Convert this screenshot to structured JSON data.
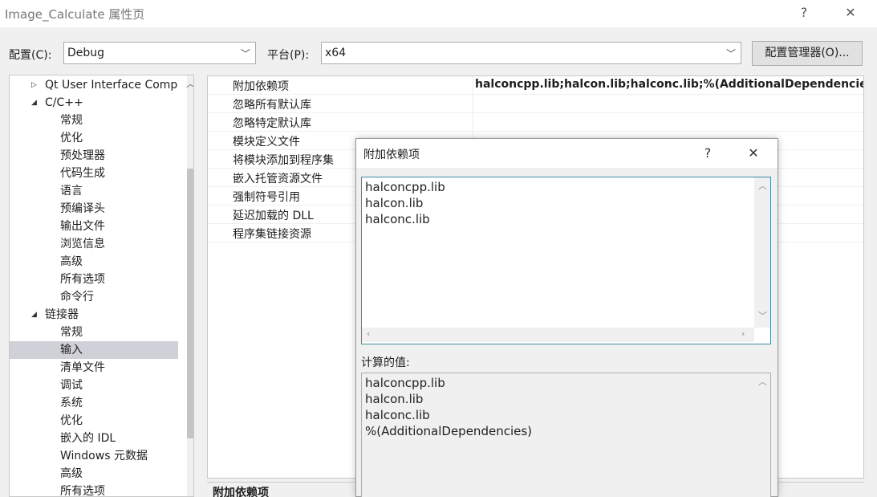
{
  "window": {
    "title": "Image_Calculate 属性页",
    "help_glyph": "?",
    "close_glyph": "✕"
  },
  "config_bar": {
    "config_label": "配置(C):",
    "config_value": "Debug",
    "platform_label": "平台(P):",
    "platform_value": "x64",
    "manager_button": "配置管理器(O)..."
  },
  "tree": {
    "items": [
      {
        "label": "Qt User Interface Comp",
        "level": 1,
        "arrow": "▷"
      },
      {
        "label": "C/C++",
        "level": 1,
        "arrow": "◢"
      },
      {
        "label": "常规",
        "level": 2
      },
      {
        "label": "优化",
        "level": 2
      },
      {
        "label": "预处理器",
        "level": 2
      },
      {
        "label": "代码生成",
        "level": 2
      },
      {
        "label": "语言",
        "level": 2
      },
      {
        "label": "预编译头",
        "level": 2
      },
      {
        "label": "输出文件",
        "level": 2
      },
      {
        "label": "浏览信息",
        "level": 2
      },
      {
        "label": "高级",
        "level": 2
      },
      {
        "label": "所有选项",
        "level": 2
      },
      {
        "label": "命令行",
        "level": 2
      },
      {
        "label": "链接器",
        "level": 1,
        "arrow": "◢"
      },
      {
        "label": "常规",
        "level": 2
      },
      {
        "label": "输入",
        "level": 2,
        "selected": true
      },
      {
        "label": "清单文件",
        "level": 2
      },
      {
        "label": "调试",
        "level": 2
      },
      {
        "label": "系统",
        "level": 2
      },
      {
        "label": "优化",
        "level": 2
      },
      {
        "label": "嵌入的 IDL",
        "level": 2
      },
      {
        "label": "Windows 元数据",
        "level": 2
      },
      {
        "label": "高级",
        "level": 2
      },
      {
        "label": "所有选项",
        "level": 2
      }
    ]
  },
  "grid": {
    "rows": [
      {
        "name": "附加依赖项",
        "value": "halconcpp.lib;halcon.lib;halconc.lib;%(AdditionalDependencies)"
      },
      {
        "name": "忽略所有默认库",
        "value": ""
      },
      {
        "name": "忽略特定默认库",
        "value": ""
      },
      {
        "name": "模块定义文件",
        "value": ""
      },
      {
        "name": "将模块添加到程序集",
        "value": ""
      },
      {
        "name": "嵌入托管资源文件",
        "value": ""
      },
      {
        "name": "强制符号引用",
        "value": ""
      },
      {
        "name": "延迟加载的 DLL",
        "value": ""
      },
      {
        "name": "程序集链接资源",
        "value": ""
      }
    ],
    "description_title": "附加依赖项"
  },
  "dialog": {
    "title": "附加依赖项",
    "help_glyph": "?",
    "close_glyph": "✕",
    "edit_lines": [
      "halconcpp.lib",
      "halcon.lib",
      "halconc.lib"
    ],
    "computed_label": "计算的值:",
    "computed_lines": [
      "halconcpp.lib",
      "halcon.lib",
      "halconc.lib",
      "%(AdditionalDependencies)"
    ]
  }
}
